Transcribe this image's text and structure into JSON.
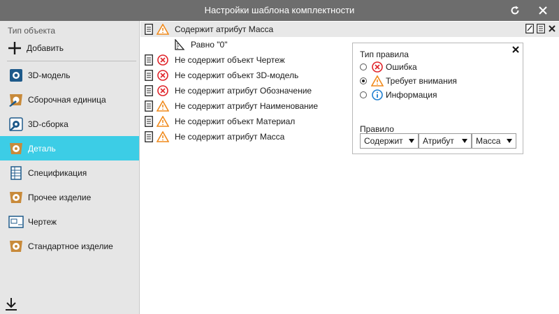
{
  "window": {
    "title": "Настройки шаблона комплектности"
  },
  "sidebar": {
    "header": "Тип объекта",
    "add_label": "Добавить",
    "items": [
      {
        "label": "3D-модель",
        "icon": "3d-model-icon"
      },
      {
        "label": "Сборочная единица",
        "icon": "assembly-unit-icon"
      },
      {
        "label": "3D-сборка",
        "icon": "3d-assembly-icon"
      },
      {
        "label": "Деталь",
        "icon": "part-icon",
        "active": true
      },
      {
        "label": "Спецификация",
        "icon": "specification-icon"
      },
      {
        "label": "Прочее изделие",
        "icon": "other-item-icon"
      },
      {
        "label": "Чертеж",
        "icon": "drawing-icon"
      },
      {
        "label": "Стандартное изделие",
        "icon": "standard-item-icon"
      }
    ]
  },
  "rules": [
    {
      "status": "warning",
      "text": "Содержит атрибут Масса",
      "selected": true,
      "sub": "Равно \"0\""
    },
    {
      "status": "error",
      "text": "Не содержит объект Чертеж"
    },
    {
      "status": "error",
      "text": "Не содержит объект 3D-модель"
    },
    {
      "status": "error",
      "text": "Не содержит атрибут Обозначение"
    },
    {
      "status": "warning",
      "text": "Не содержит атрибут Наименование"
    },
    {
      "status": "warning",
      "text": "Не содержит объект Материал"
    },
    {
      "status": "warning",
      "text": "Не содержит атрибут Масса"
    }
  ],
  "panel": {
    "type_title": "Тип правила",
    "options": [
      {
        "label": "Ошибка",
        "icon": "error-icon",
        "checked": false
      },
      {
        "label": "Требует внимания",
        "icon": "warning-icon",
        "checked": true
      },
      {
        "label": "Информация",
        "icon": "info-icon",
        "checked": false
      }
    ],
    "rule_title": "Правило",
    "dropdowns": [
      "Содержит",
      "Атрибут",
      "Масса"
    ]
  },
  "colors": {
    "titlebar": "#6d6d6d",
    "accent": "#3ccde6",
    "error": "#e0242a",
    "warning": "#f08a1c",
    "info": "#1f7fd1"
  }
}
